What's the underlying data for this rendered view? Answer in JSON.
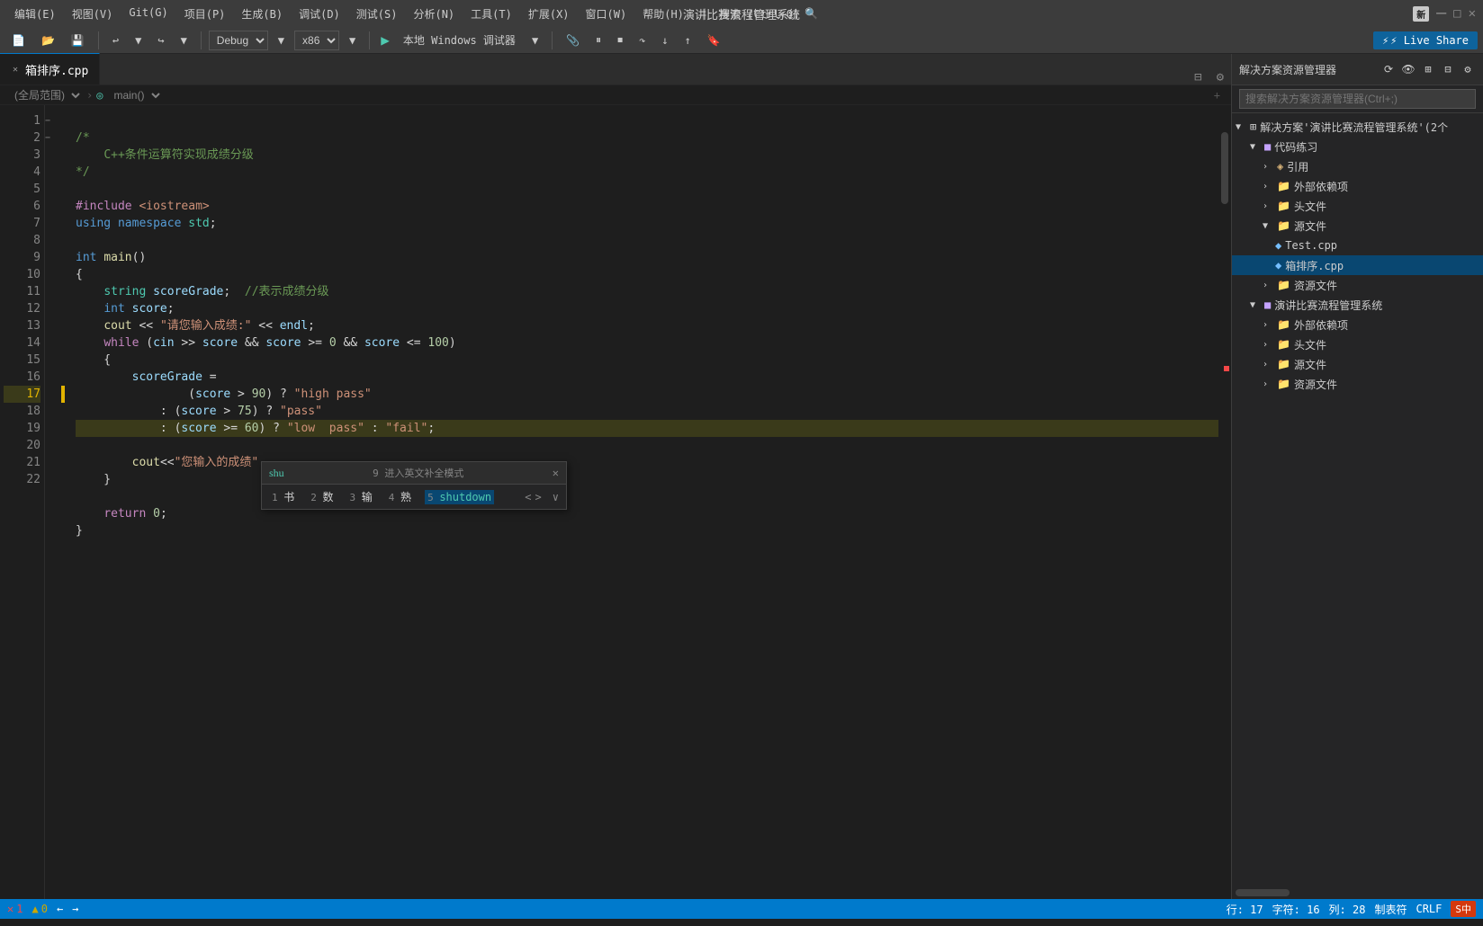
{
  "titlebar": {
    "menu_items": [
      "编辑(E)",
      "视图(V)",
      "Git(G)",
      "项目(P)",
      "生成(B)",
      "调试(D)",
      "测试(S)",
      "分析(N)",
      "工具(T)",
      "扩展(X)",
      "窗口(W)",
      "帮助(H)"
    ],
    "search_placeholder": "搜索 (Ctrl+Q)",
    "app_title": "演讲比赛流程管理系统",
    "badge": "新"
  },
  "toolbar": {
    "config_label": "Debug",
    "arch_label": "x86",
    "run_label": "▶",
    "run_target": "本地 Windows 调试器",
    "live_share_label": "⚡ Live Share"
  },
  "editor": {
    "tab_label": "箱排序.cpp",
    "breadcrumb_scope": "(全局范围)",
    "breadcrumb_func": "main()",
    "lines": [
      {
        "num": 1,
        "text": "/*"
      },
      {
        "num": 2,
        "text": "    C++条件运算符实现成绩分级"
      },
      {
        "num": 3,
        "text": "*/"
      },
      {
        "num": 4,
        "text": "#include <iostream>"
      },
      {
        "num": 5,
        "text": "using namespace std;"
      },
      {
        "num": 6,
        "text": ""
      },
      {
        "num": 7,
        "text": "int main()"
      },
      {
        "num": 8,
        "text": "{"
      },
      {
        "num": 9,
        "text": "    string scoreGrade;  //表示成绩分级"
      },
      {
        "num": 10,
        "text": "    int score;"
      },
      {
        "num": 11,
        "text": "    cout << \"请您输入成绩:\" << endl;"
      },
      {
        "num": 12,
        "text": "    while (cin >> score && score >= 0 && score <= 100)"
      },
      {
        "num": 13,
        "text": "    {"
      },
      {
        "num": 14,
        "text": "        scoreGrade ="
      },
      {
        "num": 15,
        "text": "                (score > 90) ? \"high pass\""
      },
      {
        "num": 16,
        "text": "            : (score > 75) ? \"pass\""
      },
      {
        "num": 17,
        "text": "            : (score >= 60) ? \"low  pass\" : \"fail\";"
      },
      {
        "num": 18,
        "text": "        cout<<\"您输入的成绩\""
      },
      {
        "num": 19,
        "text": "    }"
      },
      {
        "num": 20,
        "text": ""
      },
      {
        "num": 21,
        "text": "    return 0;"
      },
      {
        "num": 22,
        "text": "}"
      }
    ]
  },
  "autocomplete": {
    "input_text": "shu",
    "hint": "9 进入英文补全模式",
    "candidates": [
      {
        "num": "1",
        "label": "书"
      },
      {
        "num": "2",
        "label": "数"
      },
      {
        "num": "3",
        "label": "输"
      },
      {
        "num": "4",
        "label": "熟"
      },
      {
        "num": "5",
        "label": "shutdown",
        "highlighted": true
      }
    ]
  },
  "solution_explorer": {
    "title": "解决方案资源管理器",
    "search_placeholder": "搜索解决方案资源管理器(Ctrl+;)",
    "solution_label": "解决方案'演讲比赛流程管理系统'(2个",
    "items": [
      {
        "label": "代码练习",
        "level": 2,
        "type": "project",
        "expanded": true
      },
      {
        "label": "引用",
        "level": 3,
        "type": "folder",
        "expanded": false
      },
      {
        "label": "外部依赖项",
        "level": 3,
        "type": "folder",
        "expanded": false
      },
      {
        "label": "头文件",
        "level": 3,
        "type": "folder",
        "expanded": false
      },
      {
        "label": "源文件",
        "level": 3,
        "type": "folder",
        "expanded": true
      },
      {
        "label": "Test.cpp",
        "level": 4,
        "type": "file"
      },
      {
        "label": "箱排序.cpp",
        "level": 4,
        "type": "file"
      },
      {
        "label": "资源文件",
        "level": 3,
        "type": "folder",
        "expanded": false
      },
      {
        "label": "演讲比赛流程管理系统",
        "level": 2,
        "type": "project",
        "expanded": true
      },
      {
        "label": "外部依赖项",
        "level": 3,
        "type": "folder",
        "expanded": false
      },
      {
        "label": "头文件",
        "level": 3,
        "type": "folder",
        "expanded": false
      },
      {
        "label": "源文件",
        "level": 3,
        "type": "folder",
        "expanded": false
      },
      {
        "label": "资源文件",
        "level": 3,
        "type": "folder",
        "expanded": false
      }
    ]
  },
  "statusbar": {
    "errors": "1",
    "warnings": "0",
    "nav_back": "←",
    "nav_fwd": "→",
    "row_label": "行: 17",
    "col_label": "字符: 16",
    "col2_label": "列: 28",
    "encoding": "制表符",
    "line_ending": "CRLF"
  },
  "icons": {
    "error_icon": "✕",
    "warning_icon": "▲",
    "chevron_right": "›",
    "chevron_down": "⌄",
    "arrow_left": "←",
    "arrow_right": "→",
    "expand": "∨",
    "collapse": "−",
    "search": "🔍",
    "flash": "⚡"
  }
}
